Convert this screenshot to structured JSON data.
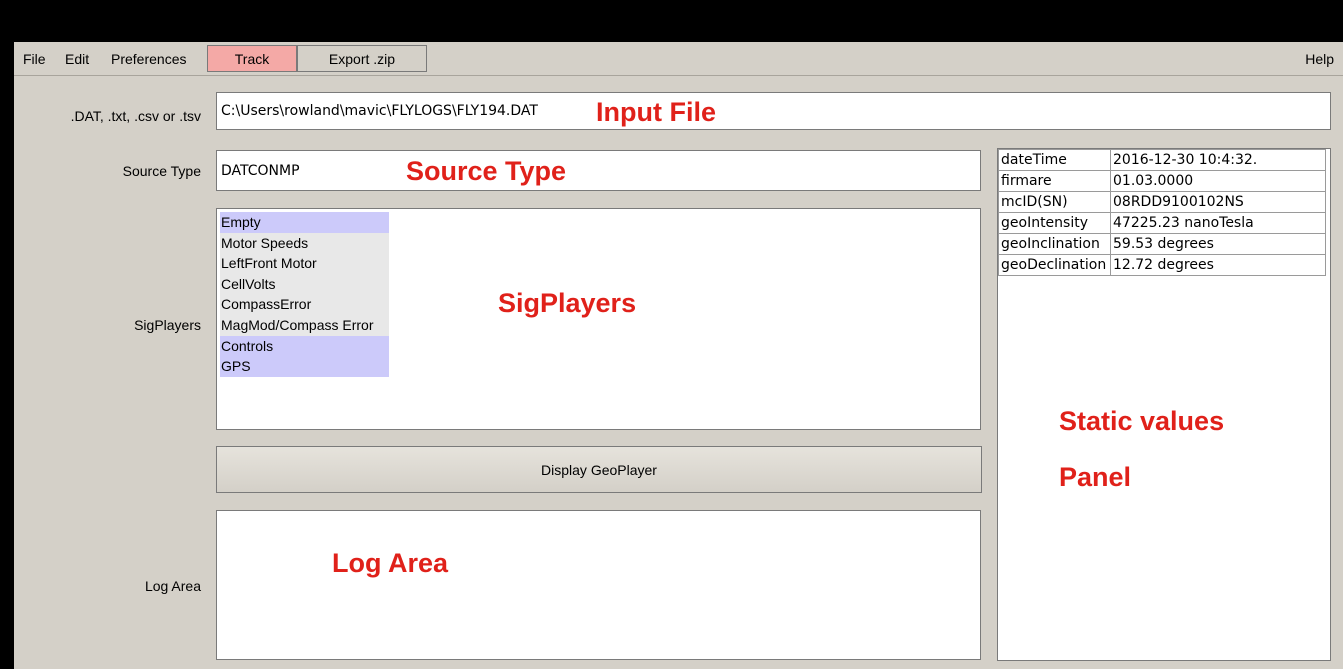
{
  "menubar": {
    "file": "File",
    "edit": "Edit",
    "preferences": "Preferences",
    "track": "Track",
    "export": "Export .zip",
    "help": "Help",
    "track_color": "#f4a9a6"
  },
  "input_file": {
    "label": ".DAT, .txt, .csv or .tsv",
    "value": "C:\\Users\\rowland\\mavic\\FLYLOGS\\FLY194.DAT",
    "annotation": "Input File"
  },
  "source_type": {
    "label": "Source Type",
    "value": "DATCONMP",
    "annotation": "Source Type"
  },
  "sigplayers": {
    "label": "SigPlayers",
    "annotation": "SigPlayers",
    "items": [
      {
        "label": "Empty",
        "style": "blue"
      },
      {
        "label": "Motor Speeds",
        "style": "gray"
      },
      {
        "label": "LeftFront Motor",
        "style": "gray"
      },
      {
        "label": "CellVolts",
        "style": "gray"
      },
      {
        "label": "CompassError",
        "style": "gray"
      },
      {
        "label": "MagMod/Compass Error",
        "style": "gray"
      },
      {
        "label": "Controls",
        "style": "blue"
      },
      {
        "label": "GPS",
        "style": "blue"
      }
    ]
  },
  "geoplayer": {
    "button": "Display GeoPlayer"
  },
  "log_area": {
    "label": "Log Area",
    "annotation": "Log Area"
  },
  "static_panel": {
    "annotation_line1": "Static values",
    "annotation_line2": "Panel",
    "rows": [
      {
        "key": "dateTime",
        "value": "2016-12-30 10:4:32."
      },
      {
        "key": "firmare",
        "value": "01.03.0000"
      },
      {
        "key": "mcID(SN)",
        "value": "08RDD9100102NS"
      },
      {
        "key": "geoIntensity",
        "value": "47225.23 nanoTesla"
      },
      {
        "key": "geoInclination",
        "value": "59.53 degrees"
      },
      {
        "key": "geoDeclination",
        "value": "12.72 degrees"
      }
    ]
  }
}
